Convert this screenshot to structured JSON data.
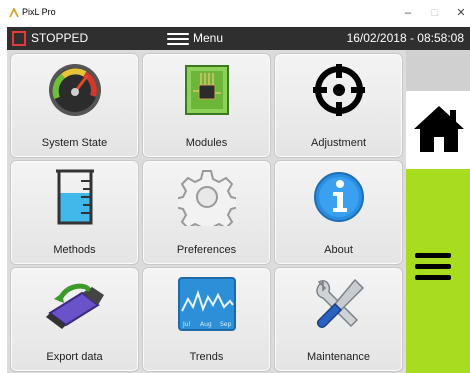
{
  "window": {
    "title": "PixL Pro",
    "controls": {
      "minimize": "–",
      "maximize": "□",
      "close": "✕"
    }
  },
  "header": {
    "status": "STOPPED",
    "menu_label": "Menu",
    "datetime": "16/02/2018 - 08:58:08",
    "colors": {
      "background": "#2f2f2f",
      "stop_indicator": "#e23a3a"
    }
  },
  "tiles": [
    {
      "label": "System State",
      "icon": "gauge-icon"
    },
    {
      "label": "Modules",
      "icon": "circuit-board-icon"
    },
    {
      "label": "Adjustment",
      "icon": "crosshair-icon"
    },
    {
      "label": "Methods",
      "icon": "beaker-icon"
    },
    {
      "label": "Preferences",
      "icon": "gear-icon"
    },
    {
      "label": "About",
      "icon": "info-icon"
    },
    {
      "label": "Export data",
      "icon": "usb-drive-icon"
    },
    {
      "label": "Trends",
      "icon": "trend-chart-icon"
    },
    {
      "label": "Maintenance",
      "icon": "tools-icon"
    }
  ],
  "trend_icon_ticks": [
    "Jul",
    "Aug",
    "Sep"
  ],
  "side_panel": {
    "home_icon": "home-icon",
    "menu_icon": "hamburger-icon",
    "colors": {
      "menu_background": "#a8dc1e"
    }
  }
}
